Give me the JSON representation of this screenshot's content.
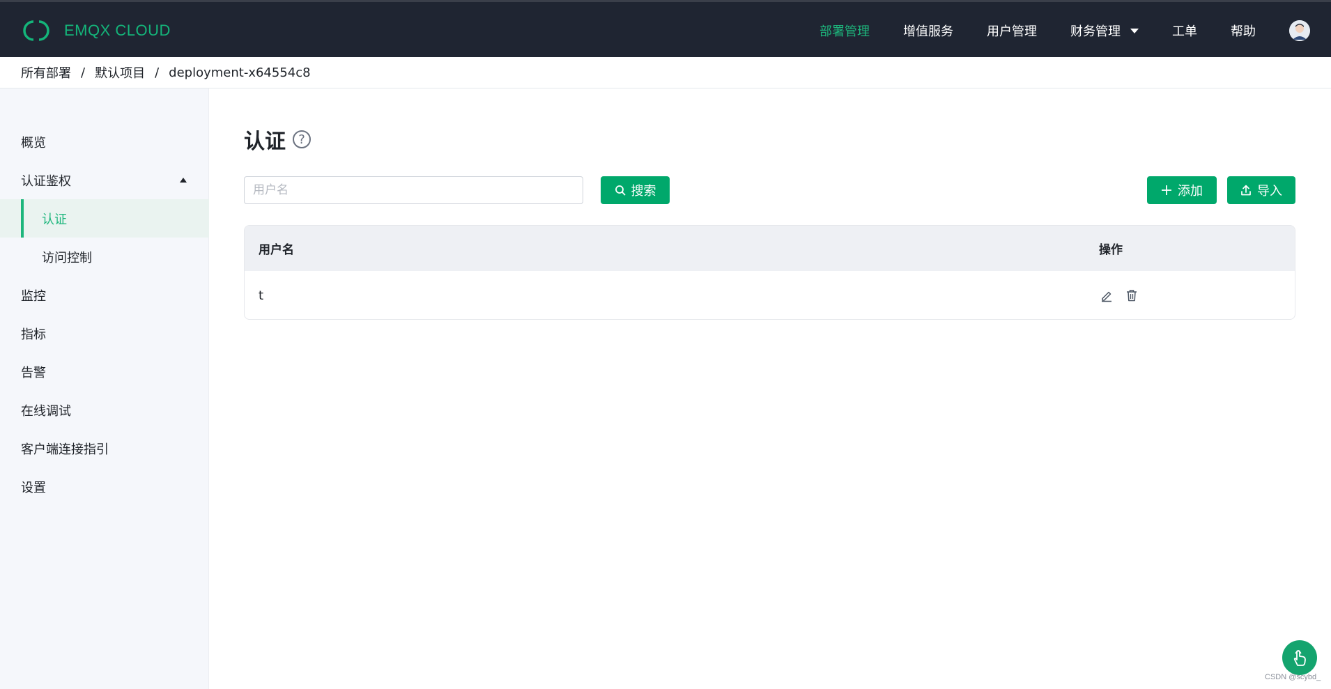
{
  "brand": {
    "name": "EMQX CLOUD",
    "color": "#14b57a"
  },
  "nav": {
    "items": [
      {
        "label": "部署管理",
        "active": true
      },
      {
        "label": "增值服务",
        "active": false
      },
      {
        "label": "用户管理",
        "active": false
      },
      {
        "label": "财务管理",
        "active": false,
        "dropdown": true
      },
      {
        "label": "工单",
        "active": false
      },
      {
        "label": "帮助",
        "active": false
      }
    ]
  },
  "breadcrumb": [
    "所有部署",
    "默认项目",
    "deployment-x64554c8"
  ],
  "sidebar": {
    "items": [
      {
        "label": "概览"
      },
      {
        "label": "认证鉴权",
        "expanded": true
      },
      {
        "label": "认证",
        "active": true,
        "sub": true
      },
      {
        "label": "访问控制",
        "sub": true
      },
      {
        "label": "监控"
      },
      {
        "label": "指标"
      },
      {
        "label": "告警"
      },
      {
        "label": "在线调试"
      },
      {
        "label": "客户端连接指引"
      },
      {
        "label": "设置"
      }
    ]
  },
  "page": {
    "title": "认证",
    "help_icon": "question-circle-icon"
  },
  "search": {
    "placeholder": "用户名",
    "value": "",
    "button_label": "搜索"
  },
  "toolbar": {
    "add_label": "添加",
    "import_label": "导入"
  },
  "table": {
    "columns": [
      "用户名",
      "操作"
    ],
    "rows": [
      {
        "username": "t"
      }
    ]
  },
  "watermark": "CSDN @scybd_",
  "colors": {
    "accent": "#00a86b",
    "nav_bg": "#1f2532",
    "sidebar_bg": "#f5f7fb"
  }
}
